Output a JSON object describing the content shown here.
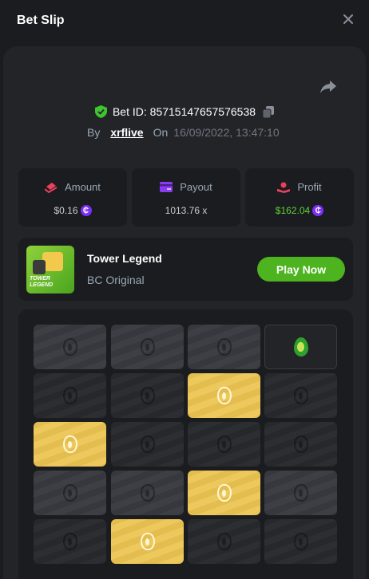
{
  "header": {
    "title": "Bet Slip"
  },
  "bet": {
    "id_label": "Bet ID: 85715147657576538",
    "by_label": "By",
    "user": "xrflive",
    "on_label": "On",
    "date": "16/09/2022, 13:47:10"
  },
  "stats": {
    "amount": {
      "label": "Amount",
      "value": "$0.16"
    },
    "payout": {
      "label": "Payout",
      "value": "1013.76 x"
    },
    "profit": {
      "label": "Profit",
      "value": "$162.04"
    }
  },
  "game": {
    "name": "Tower Legend",
    "provider": "BC Original",
    "play_label": "Play Now",
    "thumb_text": "TOWER LEGEND"
  },
  "currency_icon": "coin-icon",
  "colors": {
    "accent_green": "#4db31e",
    "profit_green": "#5fd33a",
    "gold": "#e4bd4f"
  },
  "board": {
    "rows": [
      [
        "gray",
        "gray",
        "gray",
        "gem"
      ],
      [
        "dark",
        "dark",
        "gold",
        "dark"
      ],
      [
        "gold",
        "dark",
        "dark",
        "dark"
      ],
      [
        "gray",
        "gray",
        "gold",
        "gray"
      ],
      [
        "dark",
        "gold",
        "dark",
        "dark"
      ]
    ]
  }
}
